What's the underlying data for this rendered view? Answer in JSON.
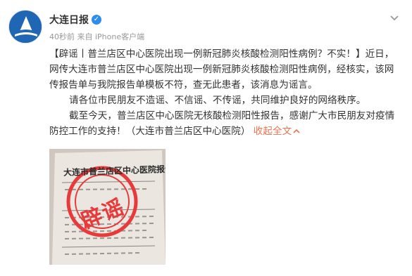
{
  "post": {
    "author": "大连日报",
    "meta": "40秒前 来自 iPhone客户端",
    "paragraphs": [
      "【辟谣丨普兰店区中心医院出现一例新冠肺炎核酸检测阳性病例？不实！】近日，网传大连市普兰店区中心医院出现一例新冠肺炎核酸检测阳性病例，经核实，该网传报告单与我院报告单模板不符，查无此患者，该消息为谣言。",
      "请各位市民朋友不造谣、不信谣、不传谣，共同维护良好的网络秩序。",
      "截至今天，普兰店区中心医院无核酸检测阳性报告，感谢广大市民朋友对疫情防控工作的支持！（大连市普兰店区中心医院）"
    ],
    "collapse_link": "收起全文",
    "collapse_icon": "chevron-up-icon"
  },
  "image": {
    "doc_title": "大连市普兰店区中心医院报告单",
    "stamp": "辟谣"
  },
  "colors": {
    "link": "#eb7350",
    "verified": "#2d8cf0",
    "stamp": "#e83a3a",
    "avatar": "#1f67b4"
  }
}
